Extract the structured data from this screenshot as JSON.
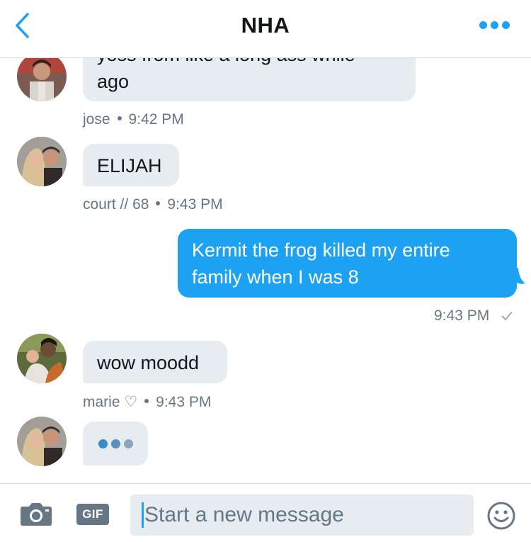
{
  "header": {
    "title": "NHA",
    "back_icon": "chevron-left-icon",
    "more_icon": "more-dots-icon",
    "accent": "#1da1f2"
  },
  "messages": [
    {
      "direction": "in",
      "text_clipped": "yoss from like a long ass while",
      "text": "ago",
      "author": "jose",
      "time": "9:42 PM",
      "avatar": "avatar-jose"
    },
    {
      "direction": "in",
      "text": "ELIJAH",
      "author": "court // 68",
      "time": "9:43 PM",
      "avatar": "avatar-court"
    },
    {
      "direction": "out",
      "lines": [
        "Kermit the frog killed my entire",
        "family when I was 8"
      ],
      "time": "9:43 PM",
      "status_icon": "checkmark-icon"
    },
    {
      "direction": "in",
      "text": "wow moodd",
      "author": "marie ♡",
      "time": "9:43 PM",
      "avatar": "avatar-marie"
    }
  ],
  "typing": {
    "avatar": "avatar-court",
    "dot_colors": [
      "#3b89c9",
      "#5a8fbc",
      "#8aa6bf"
    ]
  },
  "composer": {
    "camera_icon": "camera-icon",
    "gif_label": "GIF",
    "placeholder": "Start a new message",
    "emoji_icon": "smiley-icon"
  }
}
